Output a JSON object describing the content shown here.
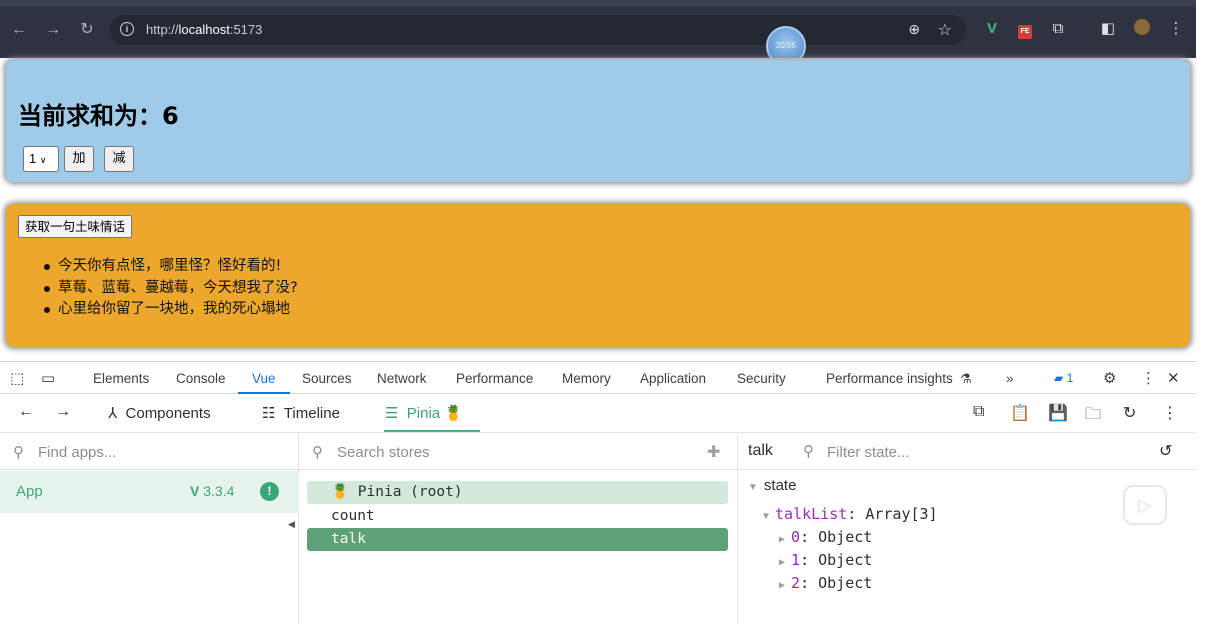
{
  "browser": {
    "url_prefix": "http://",
    "url_host": "localhost",
    "url_port": ":5173",
    "recording_time": "20:05"
  },
  "page": {
    "sum_title": "当前求和为：6",
    "step_select_value": "1",
    "add_label": "加",
    "subtract_label": "减",
    "talk_button_label": "获取一句土味情话",
    "talk_list": [
      "今天你有点怪，哪里怪？怪好看的!",
      "草莓、蓝莓、蔓越莓，今天想我了没?",
      "心里给你留了一块地，我的死心塌地"
    ]
  },
  "devtools": {
    "tabs": [
      "Elements",
      "Console",
      "Vue",
      "Sources",
      "Network",
      "Performance",
      "Memory",
      "Application",
      "Security",
      "Performance insights"
    ],
    "active_tab": "Vue",
    "overflow": "»",
    "message_count": "1"
  },
  "vue": {
    "tabs": {
      "components": "Components",
      "timeline": "Timeline",
      "pinia": "Pinia"
    },
    "find_apps_placeholder": "Find apps...",
    "search_stores_placeholder": "Search stores",
    "filter_state_placeholder": "Filter state...",
    "app": {
      "name": "App",
      "version": "3.3.4"
    },
    "stores": {
      "root": "Pinia (root)",
      "count": "count",
      "talk": "talk"
    },
    "selected_store": "talk",
    "state": {
      "section": "state",
      "list_key": "talkList",
      "list_type": "Array[3]",
      "items": [
        {
          "index": "0",
          "type": "Object"
        },
        {
          "index": "1",
          "type": "Object"
        },
        {
          "index": "2",
          "type": "Object"
        }
      ]
    }
  },
  "colors": {
    "sum_panel": "#9fcbe9",
    "talk_panel": "#eca72c",
    "vue_green": "#42b883",
    "selected_store": "#5ea174",
    "devtools_active": "#1a73e8"
  }
}
